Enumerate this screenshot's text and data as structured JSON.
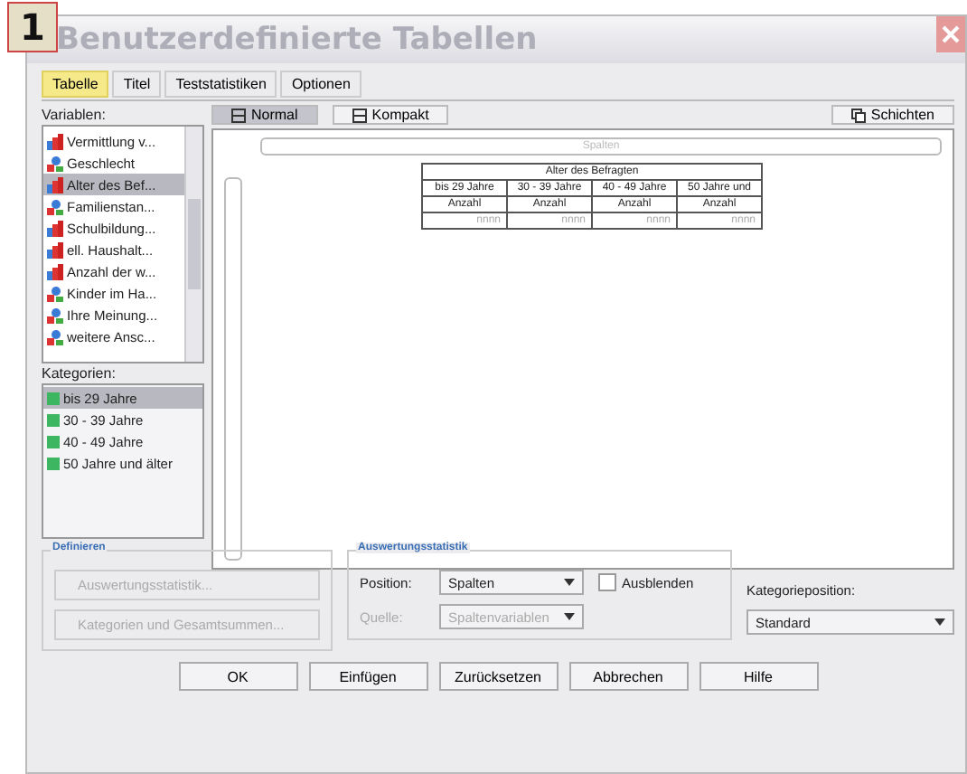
{
  "badge": "1",
  "window": {
    "title": "Benutzerdefinierte Tabellen"
  },
  "tabs": [
    {
      "label": "Tabelle",
      "selected": true
    },
    {
      "label": "Titel",
      "selected": false
    },
    {
      "label": "Teststatistiken",
      "selected": false
    },
    {
      "label": "Optionen",
      "selected": false
    }
  ],
  "view_buttons": [
    {
      "label": "Normal",
      "selected": true
    },
    {
      "label": "Kompakt",
      "selected": false
    }
  ],
  "layers_button": "Schichten",
  "variables": {
    "label": "Variablen:",
    "items": [
      {
        "name": "Vermittlung v...",
        "kind": "scale",
        "selected": false
      },
      {
        "name": "Geschlecht",
        "kind": "nominal",
        "selected": false
      },
      {
        "name": "Alter des Bef...",
        "kind": "scale",
        "selected": true
      },
      {
        "name": "Familienstan...",
        "kind": "nominal",
        "selected": false
      },
      {
        "name": "Schulbildung...",
        "kind": "scale",
        "selected": false
      },
      {
        "name": "ell. Haushalt...",
        "kind": "scale",
        "selected": false
      },
      {
        "name": "Anzahl der w...",
        "kind": "scale",
        "selected": false
      },
      {
        "name": "Kinder im Ha...",
        "kind": "nominal",
        "selected": false
      },
      {
        "name": "Ihre Meinung...",
        "kind": "nominal",
        "selected": false
      },
      {
        "name": "weitere Ansc...",
        "kind": "nominal",
        "selected": false
      }
    ]
  },
  "categories": {
    "label": "Kategorien:",
    "items": [
      {
        "name": "bis 29 Jahre",
        "selected": true
      },
      {
        "name": "30 - 39 Jahre",
        "selected": false
      },
      {
        "name": "40 - 49 Jahre",
        "selected": false
      },
      {
        "name": "50 Jahre und älter",
        "selected": false
      }
    ]
  },
  "canvas": {
    "columns_zone": "Spalten",
    "table": {
      "title": "Alter des Befragten",
      "columns": [
        "bis 29 Jahre",
        "30 - 39 Jahre",
        "40 - 49 Jahre",
        "50 Jahre und"
      ],
      "stats": [
        "Anzahl",
        "Anzahl",
        "Anzahl",
        "Anzahl"
      ],
      "values": [
        "nnnn",
        "nnnn",
        "nnnn",
        "nnnn"
      ]
    }
  },
  "define": {
    "title": "Definieren",
    "buttons": [
      {
        "label": "Auswertungsstatistik...",
        "disabled": true
      },
      {
        "label": "Kategorien und Gesamtsummen...",
        "disabled": true
      }
    ]
  },
  "summary": {
    "title": "Auswertungsstatistik",
    "position_label": "Position:",
    "position_value": "Spalten",
    "hide_label": "Ausblenden",
    "hide_checked": false,
    "source_label": "Quelle:",
    "source_value": "Spaltenvariablen",
    "source_disabled": true
  },
  "category_position": {
    "label": "Kategorieposition:",
    "value": "Standard"
  },
  "buttons": [
    "OK",
    "Einfügen",
    "Zurücksetzen",
    "Abbrechen",
    "Hilfe"
  ]
}
